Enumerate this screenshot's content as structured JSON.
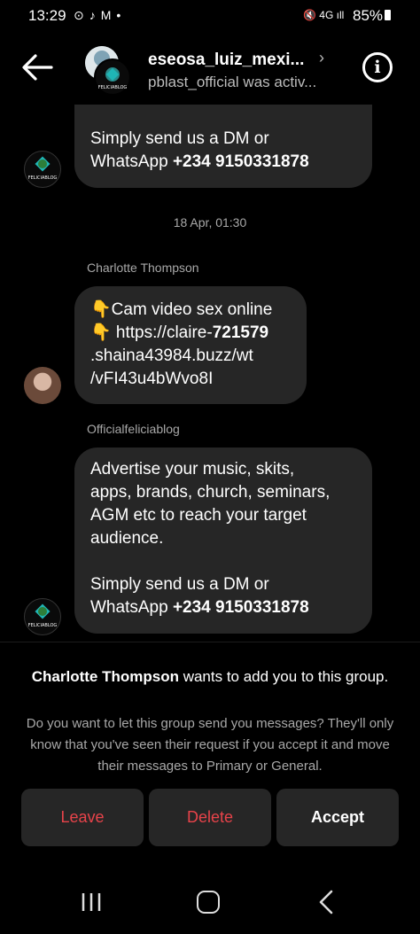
{
  "status_bar": {
    "time": "13:29",
    "notification_icons": [
      "app-icon",
      "tiktok-icon",
      "gmail-icon",
      "dot-icon"
    ],
    "signal": "4G",
    "battery": "85%"
  },
  "header": {
    "title": "eseosa_luiz_mexi...",
    "subtitle": "pblast_official was activ..."
  },
  "messages": {
    "bubble1": {
      "line1": "Simply send us a DM or",
      "line2_prefix": "WhatsApp ",
      "line2_bold": "+234 9150331878"
    },
    "date_divider": "18 Apr, 01:30",
    "sender1": "Charlotte Thompson",
    "bubble2": {
      "line1": "👇Cam video sex online",
      "line2_prefix": "👇 https://claire-",
      "line2_bold": "721579",
      "line3": ".shaina43984.buzz/wt",
      "line4": "/vFI43u4bWvo8I"
    },
    "sender2": "Officialfeliciablog",
    "bubble3": {
      "line1": "Advertise your music, skits,",
      "line2": "apps, brands, church, seminars,",
      "line3": "AGM etc to reach your target",
      "line4": "audience.",
      "line5": "Simply send us a DM or",
      "line6_prefix": "WhatsApp ",
      "line6_bold": "+234 9150331878"
    }
  },
  "request": {
    "title_bold": "Charlotte Thompson",
    "title_rest": " wants to add you to this group.",
    "body": "Do you want to let this group send you messages? They'll only know that you've seen their request if you accept it and move their messages to Primary or General.",
    "leave_label": "Leave",
    "delete_label": "Delete",
    "accept_label": "Accept"
  },
  "logo_text": "FELICIABLOG",
  "colors": {
    "bubble": "#262626",
    "danger": "#e8434a",
    "muted": "#a8a8a8"
  }
}
